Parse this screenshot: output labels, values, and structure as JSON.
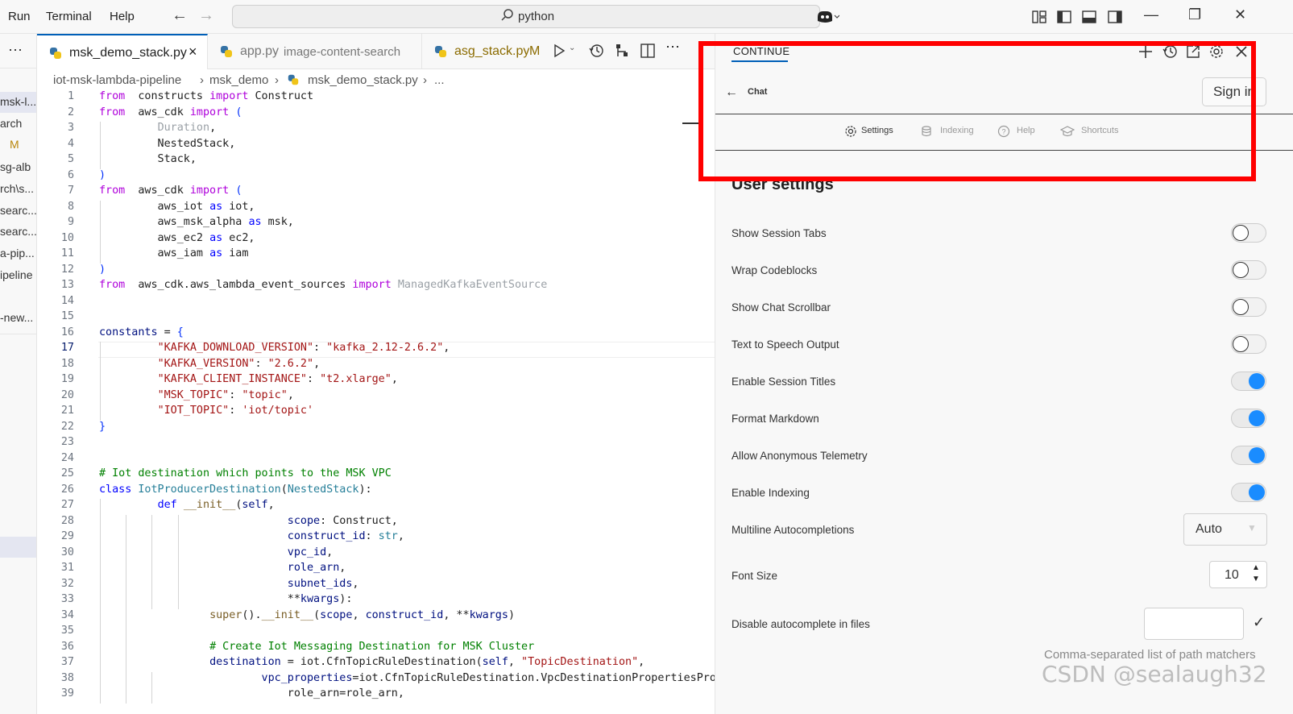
{
  "titlebar": {
    "menu": [
      "Run",
      "Terminal",
      "Help"
    ],
    "search": "python"
  },
  "explorer": {
    "rows": [
      "msk-l...",
      "arch",
      "M",
      "sg-alb",
      "rch\\s...",
      "searc...",
      "searc...",
      "a-pip...",
      "ipeline",
      "-new..."
    ]
  },
  "tabs": [
    {
      "label": "msk_demo_stack.py",
      "close": "×"
    },
    {
      "label": "app.py",
      "detail": "image-content-search"
    },
    {
      "label": "asg_stack.py",
      "badge": "M"
    }
  ],
  "breadcrumb": [
    "iot-msk-lambda-pipeline",
    "msk_demo",
    "msk_demo_stack.py",
    "..."
  ],
  "editor": {
    "current_line": 17,
    "lines": [
      {
        "n": "1",
        "parts": [
          [
            "k",
            "from"
          ],
          [
            "",
            "  constructs "
          ],
          [
            "k",
            "import"
          ],
          [
            "",
            " Construct"
          ]
        ]
      },
      {
        "n": "2",
        "parts": [
          [
            "k",
            "from"
          ],
          [
            "",
            "  aws_cdk "
          ],
          [
            "k",
            "import"
          ],
          [
            "",
            " "
          ],
          [
            "p",
            "("
          ]
        ]
      },
      {
        "n": "3",
        "parts": [
          [
            "",
            "         "
          ],
          [
            "dim",
            "Duration"
          ],
          [
            "",
            ","
          ]
        ]
      },
      {
        "n": "4",
        "parts": [
          [
            "",
            "         NestedStack,"
          ]
        ]
      },
      {
        "n": "5",
        "parts": [
          [
            "",
            "         Stack,"
          ]
        ]
      },
      {
        "n": "6",
        "parts": [
          [
            "p",
            ")"
          ]
        ]
      },
      {
        "n": "7",
        "parts": [
          [
            "k",
            "from"
          ],
          [
            "",
            "  aws_cdk "
          ],
          [
            "k",
            "import"
          ],
          [
            "",
            " "
          ],
          [
            "p",
            "("
          ]
        ]
      },
      {
        "n": "8",
        "parts": [
          [
            "",
            "         aws_iot "
          ],
          [
            "kb",
            "as"
          ],
          [
            "",
            " iot,"
          ]
        ]
      },
      {
        "n": "9",
        "parts": [
          [
            "",
            "         aws_msk_alpha "
          ],
          [
            "kb",
            "as"
          ],
          [
            "",
            " msk,"
          ]
        ]
      },
      {
        "n": "10",
        "parts": [
          [
            "",
            "         aws_ec2 "
          ],
          [
            "kb",
            "as"
          ],
          [
            "",
            " ec2,"
          ]
        ]
      },
      {
        "n": "11",
        "parts": [
          [
            "",
            "         aws_iam "
          ],
          [
            "kb",
            "as"
          ],
          [
            "",
            " iam"
          ]
        ]
      },
      {
        "n": "12",
        "parts": [
          [
            "p",
            ")"
          ]
        ]
      },
      {
        "n": "13",
        "parts": [
          [
            "k",
            "from"
          ],
          [
            "",
            "  aws_cdk.aws_lambda_event_sources "
          ],
          [
            "k",
            "import"
          ],
          [
            "",
            " "
          ],
          [
            "dim",
            "ManagedKafkaEventSource"
          ]
        ]
      },
      {
        "n": "14",
        "parts": []
      },
      {
        "n": "15",
        "parts": []
      },
      {
        "n": "16",
        "parts": [
          [
            "v",
            "constants"
          ],
          [
            "",
            " = "
          ],
          [
            "p",
            "{"
          ]
        ]
      },
      {
        "n": "17",
        "parts": [
          [
            "",
            "         "
          ],
          [
            "s",
            "\"KAFKA_DOWNLOAD_VERSION\""
          ],
          [
            "",
            ": "
          ],
          [
            "s",
            "\"kafka_2.12-2.6.2\""
          ],
          [
            "",
            ","
          ]
        ]
      },
      {
        "n": "18",
        "parts": [
          [
            "",
            "         "
          ],
          [
            "s",
            "\"KAFKA_VERSION\""
          ],
          [
            "",
            ": "
          ],
          [
            "s",
            "\"2.6.2\""
          ],
          [
            "",
            ","
          ]
        ]
      },
      {
        "n": "19",
        "parts": [
          [
            "",
            "         "
          ],
          [
            "s",
            "\"KAFKA_CLIENT_INSTANCE\""
          ],
          [
            "",
            ": "
          ],
          [
            "s",
            "\"t2.xlarge\""
          ],
          [
            "",
            ","
          ]
        ]
      },
      {
        "n": "20",
        "parts": [
          [
            "",
            "         "
          ],
          [
            "s",
            "\"MSK_TOPIC\""
          ],
          [
            "",
            ": "
          ],
          [
            "s",
            "\"topic\""
          ],
          [
            "",
            ","
          ]
        ]
      },
      {
        "n": "21",
        "parts": [
          [
            "",
            "         "
          ],
          [
            "s",
            "\"IOT_TOPIC\""
          ],
          [
            "",
            ": "
          ],
          [
            "s",
            "'iot/topic'"
          ]
        ]
      },
      {
        "n": "22",
        "parts": [
          [
            "p",
            "}"
          ]
        ]
      },
      {
        "n": "23",
        "parts": []
      },
      {
        "n": "24",
        "parts": []
      },
      {
        "n": "25",
        "parts": [
          [
            "c",
            "# Iot destination which points to the MSK VPC"
          ]
        ]
      },
      {
        "n": "26",
        "parts": [
          [
            "kb",
            "class"
          ],
          [
            "",
            " "
          ],
          [
            "t",
            "IotProducerDestination"
          ],
          [
            "",
            "("
          ],
          [
            "t",
            "NestedStack"
          ],
          [
            "",
            "):"
          ]
        ]
      },
      {
        "n": "27",
        "parts": [
          [
            "",
            "         "
          ],
          [
            "kb",
            "def"
          ],
          [
            "",
            " "
          ],
          [
            "f",
            "__init__"
          ],
          [
            "",
            "("
          ],
          [
            "v",
            "self"
          ],
          [
            "",
            ","
          ]
        ]
      },
      {
        "n": "28",
        "parts": [
          [
            "",
            "                             "
          ],
          [
            "v",
            "scope"
          ],
          [
            "",
            ": Construct,"
          ]
        ]
      },
      {
        "n": "29",
        "parts": [
          [
            "",
            "                             "
          ],
          [
            "v",
            "construct_id"
          ],
          [
            "",
            ": "
          ],
          [
            "t",
            "str"
          ],
          [
            "",
            ","
          ]
        ]
      },
      {
        "n": "30",
        "parts": [
          [
            "",
            "                             "
          ],
          [
            "v",
            "vpc_id"
          ],
          [
            "",
            ","
          ]
        ]
      },
      {
        "n": "31",
        "parts": [
          [
            "",
            "                             "
          ],
          [
            "v",
            "role_arn"
          ],
          [
            "",
            ","
          ]
        ]
      },
      {
        "n": "32",
        "parts": [
          [
            "",
            "                             "
          ],
          [
            "v",
            "subnet_ids"
          ],
          [
            "",
            ","
          ]
        ]
      },
      {
        "n": "33",
        "parts": [
          [
            "",
            "                             **"
          ],
          [
            "v",
            "kwargs"
          ],
          [
            "",
            "):"
          ]
        ]
      },
      {
        "n": "34",
        "parts": [
          [
            "",
            "                 "
          ],
          [
            "f",
            "super"
          ],
          [
            "",
            "()."
          ],
          [
            "f",
            "__init__"
          ],
          [
            "",
            "("
          ],
          [
            "v",
            "scope"
          ],
          [
            "",
            ", "
          ],
          [
            "v",
            "construct_id"
          ],
          [
            "",
            ", **"
          ],
          [
            "v",
            "kwargs"
          ],
          [
            "",
            ")"
          ]
        ]
      },
      {
        "n": "35",
        "parts": []
      },
      {
        "n": "36",
        "parts": [
          [
            "",
            "                 "
          ],
          [
            "c",
            "# Create Iot Messaging Destination for MSK Cluster"
          ]
        ]
      },
      {
        "n": "37",
        "parts": [
          [
            "",
            "                 "
          ],
          [
            "v",
            "destination"
          ],
          [
            "",
            " = iot.CfnTopicRuleDestination("
          ],
          [
            "v",
            "self"
          ],
          [
            "",
            ", "
          ],
          [
            "s",
            "\"TopicDestination\""
          ],
          [
            "",
            ","
          ]
        ]
      },
      {
        "n": "38",
        "parts": [
          [
            "",
            "                         "
          ],
          [
            "v",
            "vpc_properties"
          ],
          [
            "",
            "=iot.CfnTopicRuleDestination.VpcDestinationPropertiesProperty("
          ]
        ]
      },
      {
        "n": "39",
        "parts": [
          [
            "",
            "                             role_arn=role_arn,"
          ]
        ]
      }
    ]
  },
  "panel": {
    "tab_label": "CONTINUE",
    "chat_title": "Chat",
    "sign_in": "Sign in",
    "nav": [
      {
        "label": "Settings",
        "icon": "gear-icon"
      },
      {
        "label": "Indexing",
        "icon": "database-icon"
      },
      {
        "label": "Help",
        "icon": "help-icon"
      },
      {
        "label": "Shortcuts",
        "icon": "graduation-cap-icon"
      }
    ],
    "heading": "User settings",
    "toggles": [
      {
        "label": "Show Session Tabs",
        "on": false
      },
      {
        "label": "Wrap Codeblocks",
        "on": false
      },
      {
        "label": "Show Chat Scrollbar",
        "on": false
      },
      {
        "label": "Text to Speech Output",
        "on": false
      },
      {
        "label": "Enable Session Titles",
        "on": true
      },
      {
        "label": "Format Markdown",
        "on": true
      },
      {
        "label": "Allow Anonymous Telemetry",
        "on": true
      },
      {
        "label": "Enable Indexing",
        "on": true
      }
    ],
    "multiline_label": "Multiline Autocompletions",
    "multiline_value": "Auto",
    "font_size_label": "Font Size",
    "font_size_value": "10",
    "disable_label": "Disable autocomplete in files",
    "disable_value": "",
    "disable_hint": "Comma-separated list of path matchers"
  },
  "watermark": "CSDN @sealaugh32",
  "colors": {
    "accent": "#005fb8",
    "highlight": "#ff0000",
    "toggle_on": "#1a8cff"
  }
}
